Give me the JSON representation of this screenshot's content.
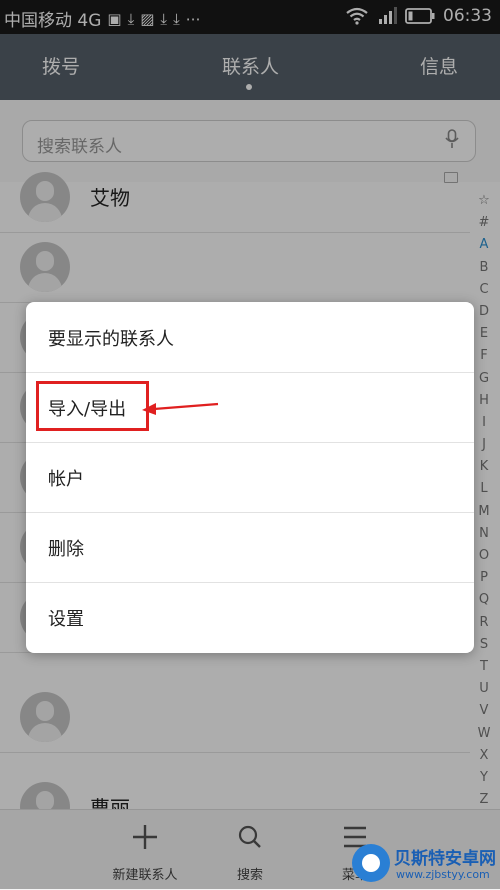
{
  "status_bar": {
    "carrier": "中国移动 4G",
    "time": "06:33"
  },
  "tabs": [
    {
      "label": "拨号"
    },
    {
      "label": "联系人"
    },
    {
      "label": "信息"
    }
  ],
  "search": {
    "placeholder": "搜索联系人"
  },
  "contacts": [
    {
      "name": "艾物"
    },
    {
      "name": ""
    },
    {
      "name": ""
    },
    {
      "name": ""
    },
    {
      "name": ""
    },
    {
      "name": ""
    },
    {
      "name": ""
    },
    {
      "name": "曹丽"
    }
  ],
  "alphabet": [
    "☆",
    "#",
    "A",
    "B",
    "C",
    "D",
    "E",
    "F",
    "G",
    "H",
    "I",
    "J",
    "K",
    "L",
    "M",
    "N",
    "O",
    "P",
    "Q",
    "R",
    "S",
    "T",
    "U",
    "V",
    "W",
    "X",
    "Y",
    "Z"
  ],
  "menu": {
    "items": [
      {
        "label": "要显示的联系人"
      },
      {
        "label": "导入/导出"
      },
      {
        "label": "帐户"
      },
      {
        "label": "删除"
      },
      {
        "label": "设置"
      }
    ]
  },
  "bottom_bar": {
    "new_contact": "新建联系人",
    "search": "搜索",
    "menu": "菜单"
  },
  "watermark": {
    "title": "贝斯特安卓网",
    "url": "www.zjbstyy.com"
  },
  "colors": {
    "tab_bar": "#56606a",
    "highlight": "#e02020",
    "alpha_active": "#2a8fd0"
  }
}
